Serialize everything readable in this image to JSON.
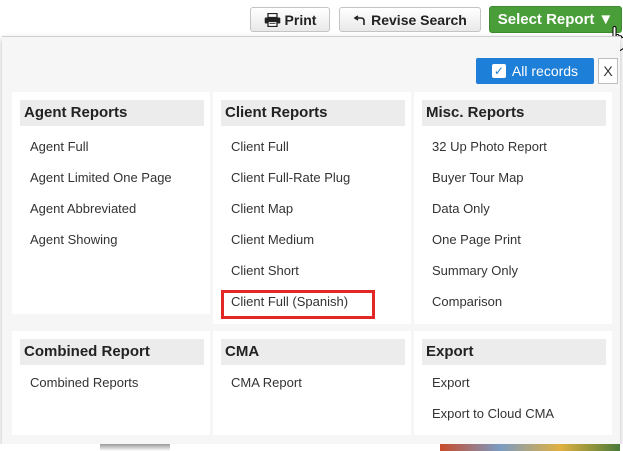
{
  "toolbar": {
    "print_label": "Print",
    "revise_label": "Revise Search",
    "select_label": "Select Report",
    "select_arrow": "▼"
  },
  "panel": {
    "all_records_label": "All records",
    "close_label": "X"
  },
  "sections": {
    "agent": {
      "title": "Agent Reports",
      "items": [
        "Agent Full",
        "Agent Limited One Page",
        "Agent Abbreviated",
        "Agent Showing"
      ]
    },
    "client": {
      "title": "Client Reports",
      "items": [
        "Client Full",
        "Client Full-Rate Plug",
        "Client Map",
        "Client Medium",
        "Client Short",
        "Client Full (Spanish)"
      ]
    },
    "misc": {
      "title": "Misc. Reports",
      "items": [
        "32 Up Photo Report",
        "Buyer Tour Map",
        "Data Only",
        "One Page Print",
        "Summary Only",
        "Comparison"
      ]
    },
    "combined": {
      "title": "Combined Report",
      "items": [
        "Combined Reports"
      ]
    },
    "cma": {
      "title": "CMA",
      "items": [
        "CMA Report"
      ]
    },
    "export": {
      "title": "Export",
      "items": [
        "Export",
        "Export to Cloud CMA"
      ]
    }
  },
  "colors": {
    "select_button": "#4a9e3a",
    "all_records_button": "#1e7fd8",
    "highlight_box": "#e32626"
  },
  "icons": {
    "print": "printer-icon",
    "revise": "revise-arrow-icon",
    "select_cursor": "hand-pointer-icon",
    "all_records": "checkbox-checked-icon"
  }
}
